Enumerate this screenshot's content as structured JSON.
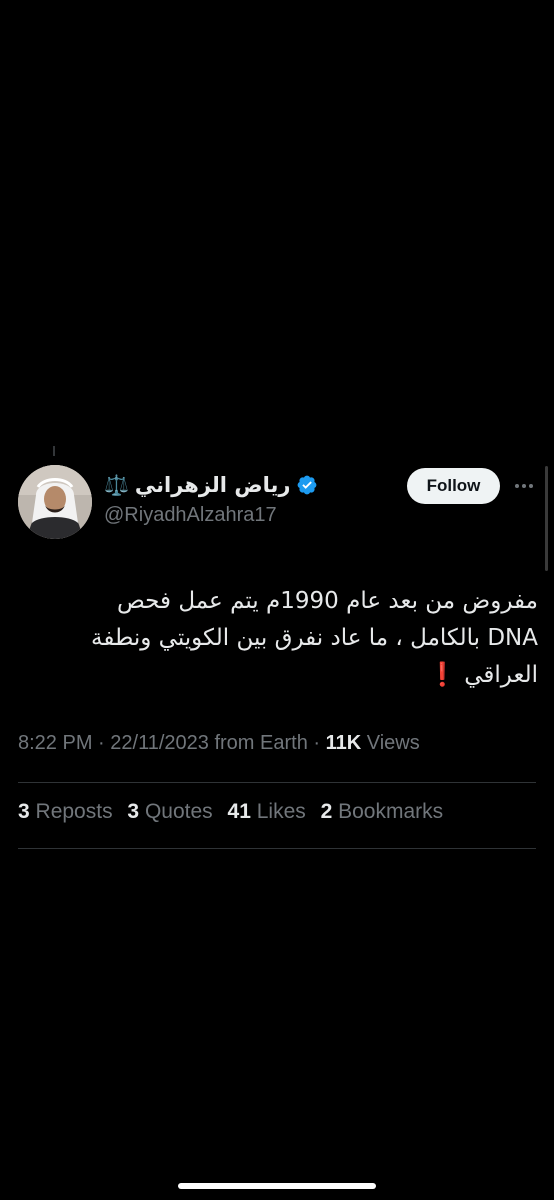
{
  "tweet": {
    "author": {
      "display_name": "رياض الزهراني",
      "name_emoji": "⚖️",
      "handle": "@RiyadhAlzahra17",
      "verified_icon": "verified-badge-icon",
      "verified_color": "#1d9bf0"
    },
    "follow_label": "Follow",
    "more_icon": "more-icon",
    "text_line1": "مفروض من بعد عام 1990م يتم عمل فحص",
    "text_line2": "DNA بالكامل ، ما عاد نفرق بين الكويتي ونطفة",
    "text_line3": "العراقي",
    "text_emoji": "❗",
    "time": "8:22 PM",
    "date": "22/11/2023",
    "source": "from Earth",
    "views_count": "11K",
    "views_label": "Views",
    "stats": {
      "reposts_count": "3",
      "reposts_label": "Reposts",
      "quotes_count": "3",
      "quotes_label": "Quotes",
      "likes_count": "41",
      "likes_label": "Likes",
      "bookmarks_count": "2",
      "bookmarks_label": "Bookmarks"
    }
  },
  "colors": {
    "background": "#000000",
    "text_primary": "#e7e9ea",
    "text_secondary": "#71767b",
    "divider": "#2f3336",
    "follow_bg": "#eff3f4"
  }
}
